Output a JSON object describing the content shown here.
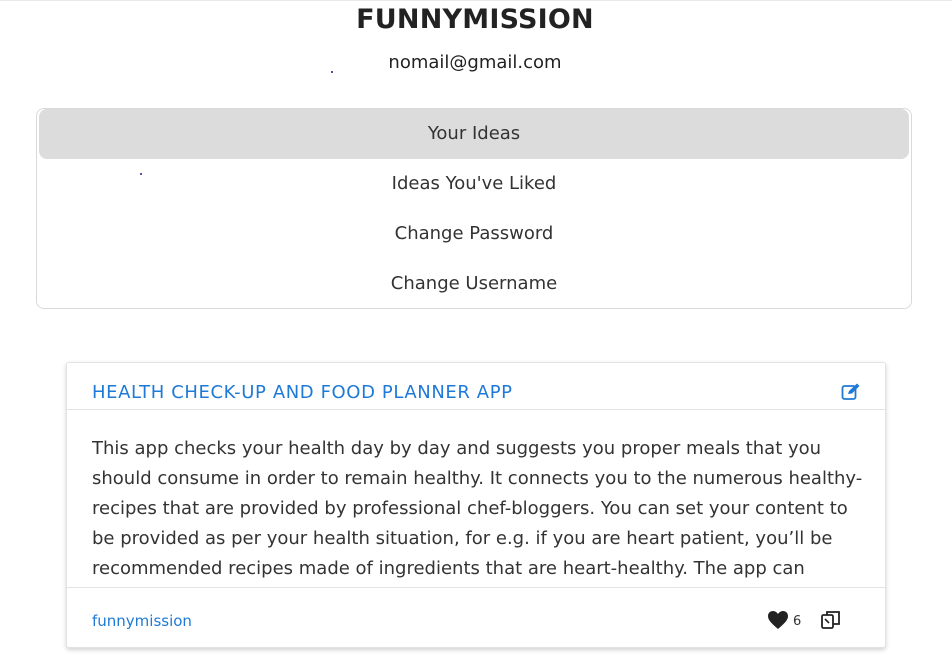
{
  "header": {
    "brand": "FUNNYMISSION",
    "email": "nomail@gmail.com"
  },
  "menu": {
    "items": [
      {
        "label": "Your Ideas",
        "active": true
      },
      {
        "label": "Ideas You've Liked",
        "active": false
      },
      {
        "label": "Change Password",
        "active": false
      },
      {
        "label": "Change Username",
        "active": false
      }
    ]
  },
  "idea_card": {
    "title": "HEALTH CHECK-UP AND FOOD PLANNER APP",
    "description": "This app checks your health day by day and suggests you proper meals that you should consume in order to remain healthy. It connects you to the numerous healthy-recipes that are provided by professional chef-bloggers. You can set your content to be provided as per your health situation, for e.g. if you are heart patient, you’ll be recommended recipes made of ingredients that are heart-healthy. The app can",
    "author": "funnymission",
    "likes": "6",
    "icons": {
      "edit": "edit-icon",
      "like": "heart-icon",
      "copy": "copy-icon"
    }
  },
  "colors": {
    "accent": "#1e7ad6",
    "active_menu_bg": "#dcdcdc",
    "border": "#d9d9d9"
  }
}
